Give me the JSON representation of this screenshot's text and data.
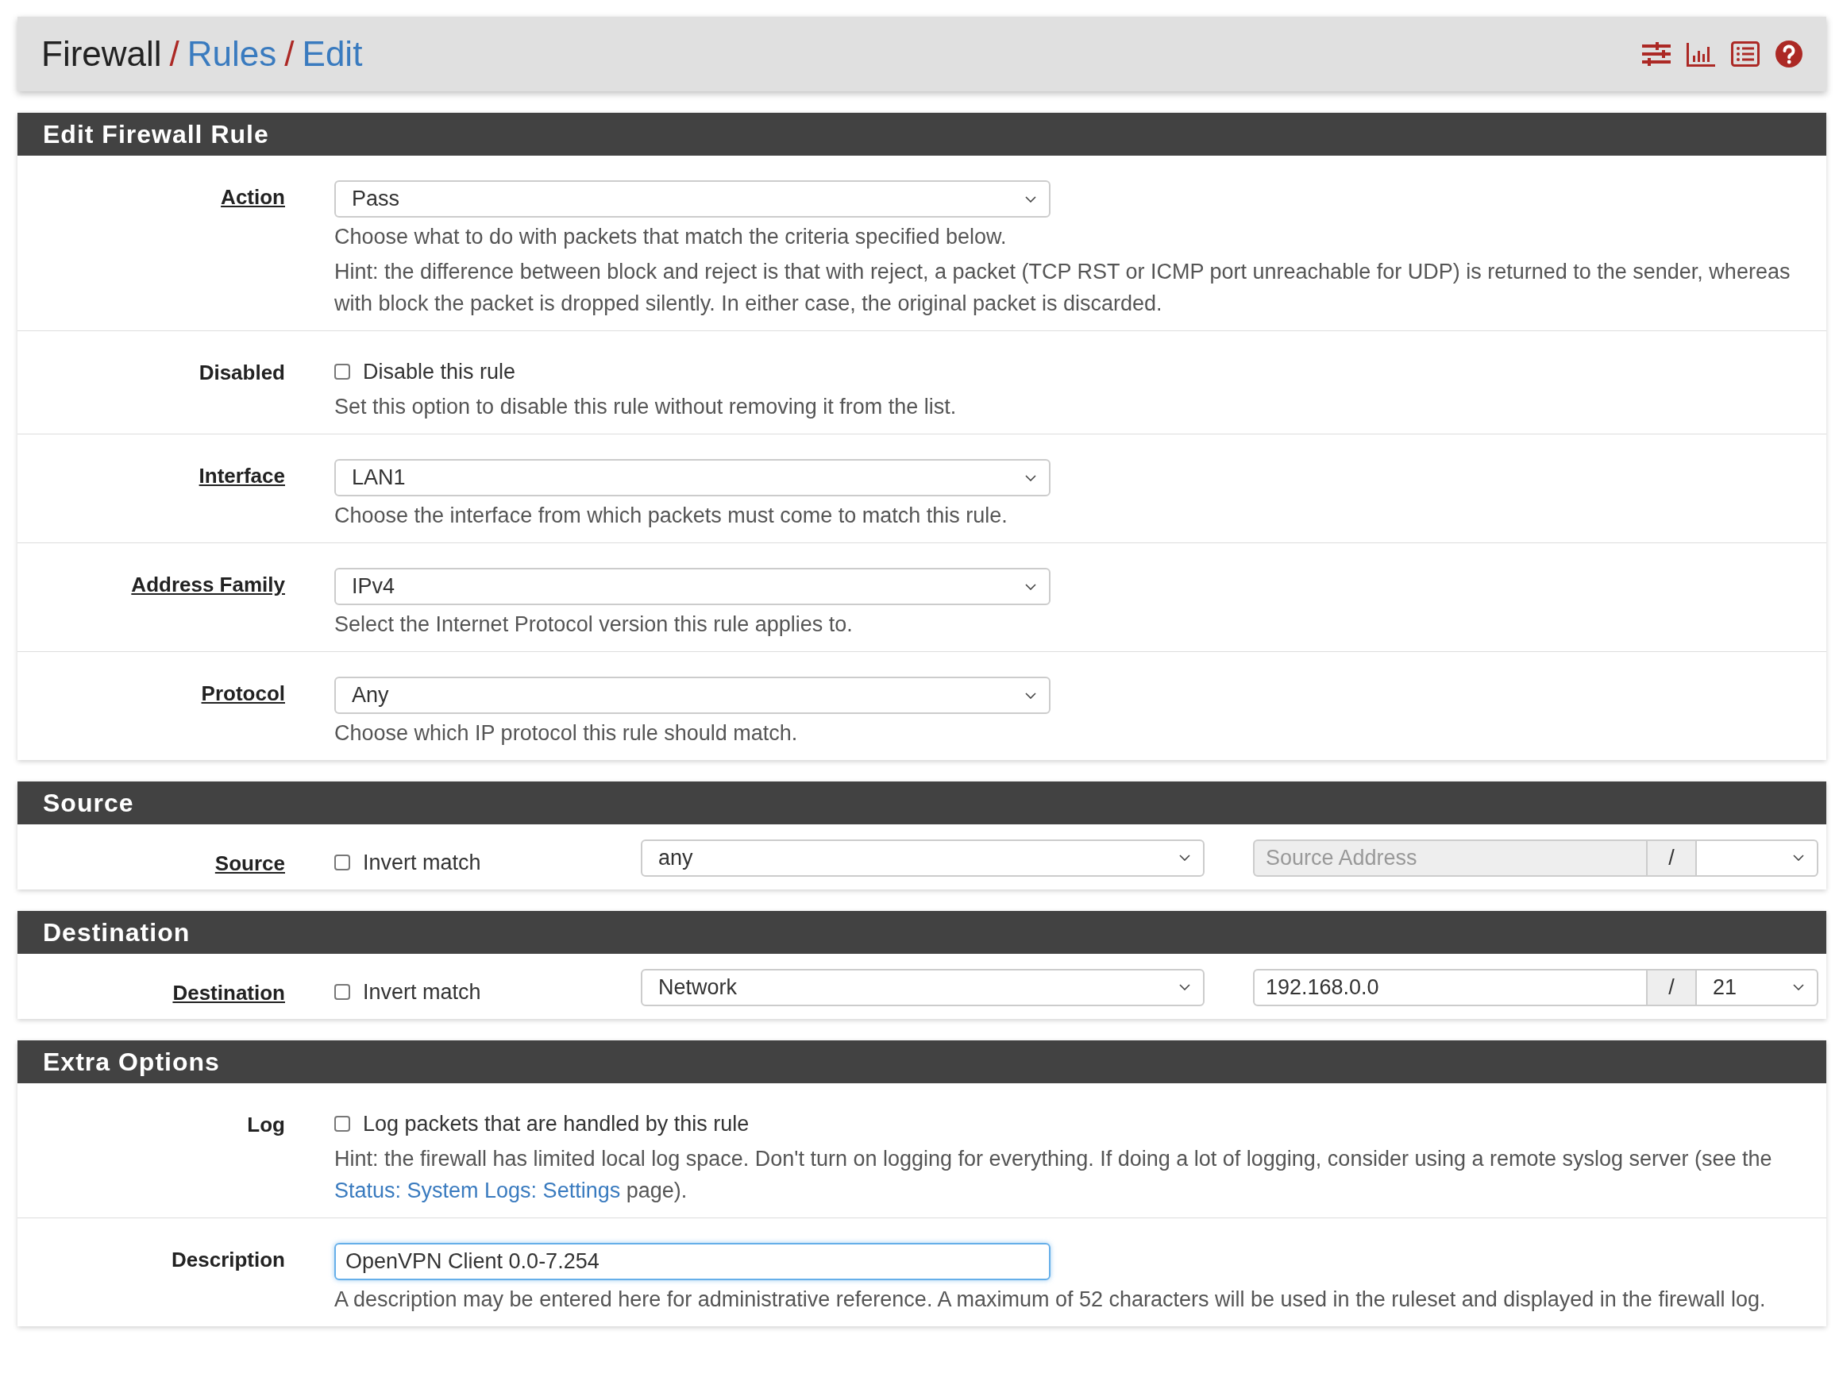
{
  "breadcrumb": [
    {
      "text": "Firewall",
      "link": false
    },
    {
      "separator": "/",
      "text": "Rules",
      "link": true
    },
    {
      "separator": "/",
      "text": "Edit",
      "link": true
    }
  ],
  "sections": [
    {
      "title": "Edit Firewall Rule",
      "rows": [
        {
          "kind": "select",
          "label": "Action",
          "label_link": true,
          "value": "Pass",
          "help": [
            "Choose what to do with packets that match the criteria specified below.",
            "Hint: the difference between block and reject is that with reject, a packet (TCP RST or ICMP port unreachable for UDP) is returned to the sender, whereas with block the packet is dropped silently. In either case, the original packet is discarded."
          ]
        },
        {
          "kind": "checkbox",
          "label": "Disabled",
          "label_link": false,
          "checked": false,
          "text": "Disable this rule",
          "help": [
            "Set this option to disable this rule without removing it from the list."
          ]
        },
        {
          "kind": "select",
          "label": "Interface",
          "label_link": true,
          "value": "LAN1",
          "help": [
            "Choose the interface from which packets must come to match this rule."
          ]
        },
        {
          "kind": "select",
          "label": "Address Family",
          "label_link": true,
          "value": "IPv4",
          "help": [
            "Select the Internet Protocol version this rule applies to."
          ]
        },
        {
          "kind": "select",
          "label": "Protocol",
          "label_link": true,
          "value": "Any",
          "help": [
            "Choose which IP protocol this rule should match."
          ]
        }
      ]
    },
    {
      "title": "Source",
      "rows": [
        {
          "kind": "address",
          "label": "Source",
          "label_link": true,
          "checked": false,
          "text": "Invert match",
          "type": "any",
          "address": {
            "placeholder": "Source Address",
            "disabled": true
          },
          "separator": "/",
          "mask": ""
        }
      ]
    },
    {
      "title": "Destination",
      "rows": [
        {
          "kind": "address",
          "label": "Destination",
          "label_link": true,
          "checked": false,
          "text": "Invert match",
          "type": "Network",
          "address": {
            "value": "192.168.0.0",
            "disabled": false
          },
          "separator": "/",
          "mask": "21"
        }
      ]
    },
    {
      "title": "Extra Options",
      "rows": [
        {
          "kind": "checkbox",
          "label": "Log",
          "label_link": false,
          "checked": false,
          "text": "Log packets that are handled by this rule",
          "help_link": {
            "before": "Hint: the firewall has limited local log space. Don't turn on logging for everything. If doing a lot of logging, consider using a remote syslog server (see the ",
            "link": "Status: System Logs: Settings",
            "after": " page)."
          }
        },
        {
          "kind": "text",
          "label": "Description",
          "label_link": false,
          "value": "OpenVPN Client 0.0-7.254",
          "focused": true,
          "help": [
            "A description may be entered here for administrative reference. A maximum of 52 characters will be used in the ruleset and displayed in the firewall log."
          ]
        }
      ]
    }
  ]
}
